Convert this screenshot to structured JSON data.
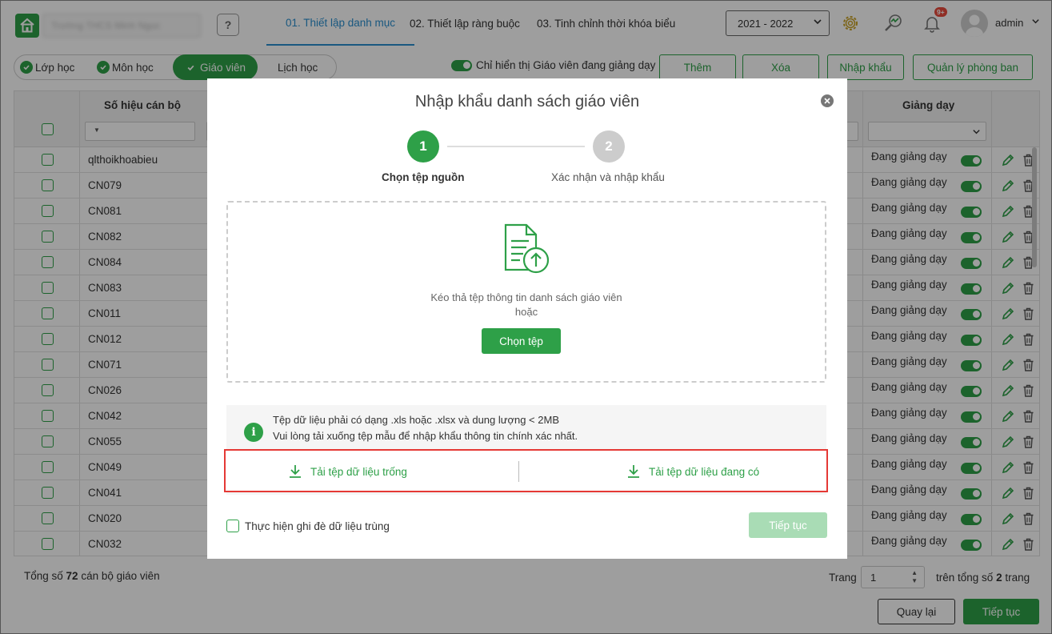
{
  "header": {
    "school_name": "Trường THCS Minh Ngọc",
    "help_label": "?",
    "tabs": [
      {
        "label": "01. Thiết lập danh mục",
        "active": true
      },
      {
        "label": "02. Thiết lập ràng buộc",
        "active": false
      },
      {
        "label": "03. Tinh chỉnh thời khóa biểu",
        "active": false
      }
    ],
    "year": "2021 - 2022",
    "notification_badge": "9+",
    "user": "admin"
  },
  "subnav": {
    "pills": [
      {
        "label": "Lớp học",
        "checked": true
      },
      {
        "label": "Môn học",
        "checked": true
      },
      {
        "label": "Giáo viên",
        "checked": true,
        "active": true
      },
      {
        "label": "Lịch học",
        "checked": false
      }
    ],
    "filter_toggle_label": "Chỉ hiển thị Giáo viên đang giảng dạy",
    "buttons": {
      "add": "Thêm",
      "delete": "Xóa",
      "import": "Nhập khẩu",
      "manage_rooms": "Quản lý phòng ban"
    }
  },
  "table": {
    "col_code": "Số hiệu cán bộ",
    "col_teaching": "Giảng dạy",
    "filter_icon": "▼",
    "rows": [
      {
        "code": "qlthoikhoabieu",
        "status": "Đang giảng dạy"
      },
      {
        "code": "CN079",
        "status": "Đang giảng dạy"
      },
      {
        "code": "CN081",
        "status": "Đang giảng dạy"
      },
      {
        "code": "CN082",
        "status": "Đang giảng dạy"
      },
      {
        "code": "CN084",
        "status": "Đang giảng dạy"
      },
      {
        "code": "CN083",
        "status": "Đang giảng dạy"
      },
      {
        "code": "CN011",
        "status": "Đang giảng dạy"
      },
      {
        "code": "CN012",
        "status": "Đang giảng dạy"
      },
      {
        "code": "CN071",
        "status": "Đang giảng dạy"
      },
      {
        "code": "CN026",
        "status": "Đang giảng dạy"
      },
      {
        "code": "CN042",
        "status": "Đang giảng dạy"
      },
      {
        "code": "CN055",
        "status": "Đang giảng dạy"
      },
      {
        "code": "CN049",
        "status": "Đang giảng dạy"
      },
      {
        "code": "CN041",
        "status": "Đang giảng dạy"
      },
      {
        "code": "CN020",
        "status": "Đang giảng dạy"
      },
      {
        "code": "CN032",
        "status": "Đang giảng dạy"
      }
    ]
  },
  "footer": {
    "total_prefix": "Tổng số",
    "total_count": "72",
    "total_suffix": "cán bộ giáo viên",
    "page_label": "Trang",
    "page_value": "1",
    "page_total_prefix": "trên tổng số",
    "page_total_count": "2",
    "page_total_suffix": "trang",
    "back": "Quay lại",
    "next": "Tiếp tục"
  },
  "modal": {
    "title": "Nhập khẩu danh sách giáo viên",
    "steps": [
      {
        "number": "1",
        "label": "Chọn tệp nguồn",
        "active": true
      },
      {
        "number": "2",
        "label": "Xác nhận và nhập khẩu",
        "active": false
      }
    ],
    "drop_text_1": "Kéo thả tệp thông tin danh sách giáo viên",
    "drop_text_2": "hoặc",
    "choose_file": "Chọn tệp",
    "info_icon": "i",
    "info_line_1": "Tệp dữ liệu phải có dạng .xls hoặc .xlsx và dung lượng < 2MB",
    "info_line_2": "Vui lòng tải xuống tệp mẫu để nhập khẩu thông tin chính xác nhất.",
    "download_empty": "Tải tệp dữ liệu trống",
    "download_existing": "Tải tệp dữ liệu đang có",
    "overwrite_label": "Thực hiện ghi đè dữ liệu trùng",
    "continue": "Tiếp tục"
  },
  "colors": {
    "green": "#2ea048",
    "blue": "#2a8fcf",
    "red_highlight": "#e53935",
    "disabled_green": "#a9dcb5"
  }
}
